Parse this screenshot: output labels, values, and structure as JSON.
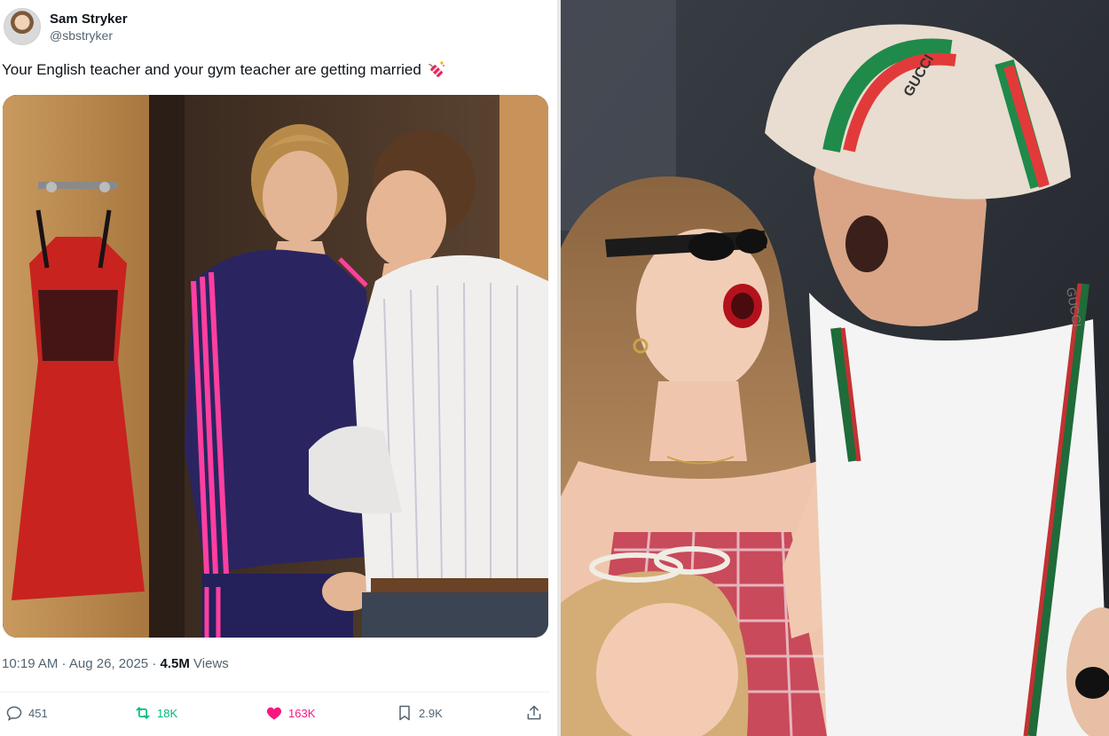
{
  "tweet": {
    "display_name": "Sam Stryker",
    "handle": "@sbstryker",
    "text": "Your English teacher and your gym teacher are getting married",
    "emoji_icon": "firecracker-icon",
    "time": "10:19 AM",
    "date": "Aug 26, 2025",
    "views_count": "4.5M",
    "views_label": "Views",
    "replies": "451",
    "retweets": "18K",
    "likes": "163K",
    "bookmarks": "2.9K",
    "colors": {
      "retweet": "#00ba7c",
      "like": "#f91880",
      "text": "#0f1419",
      "muted": "#536471"
    }
  },
  "photo": {
    "hat_text": "GUCCI",
    "collar_text": "GUCCI"
  }
}
